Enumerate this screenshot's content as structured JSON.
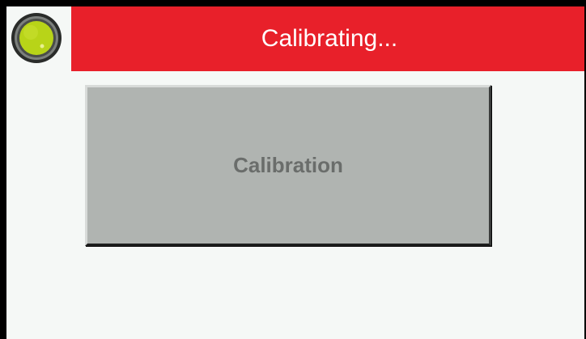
{
  "header": {
    "title": "Calibrating...",
    "status_icon": "knob-indicator-icon",
    "color": "#e8202a"
  },
  "main": {
    "calibration_button_label": "Calibration"
  },
  "colors": {
    "header_background": "#e8202a",
    "screen_background": "#f5f8f6",
    "button_background": "#b0b4b1",
    "button_text": "#6a6d6b",
    "knob_fill": "#b8d418"
  }
}
